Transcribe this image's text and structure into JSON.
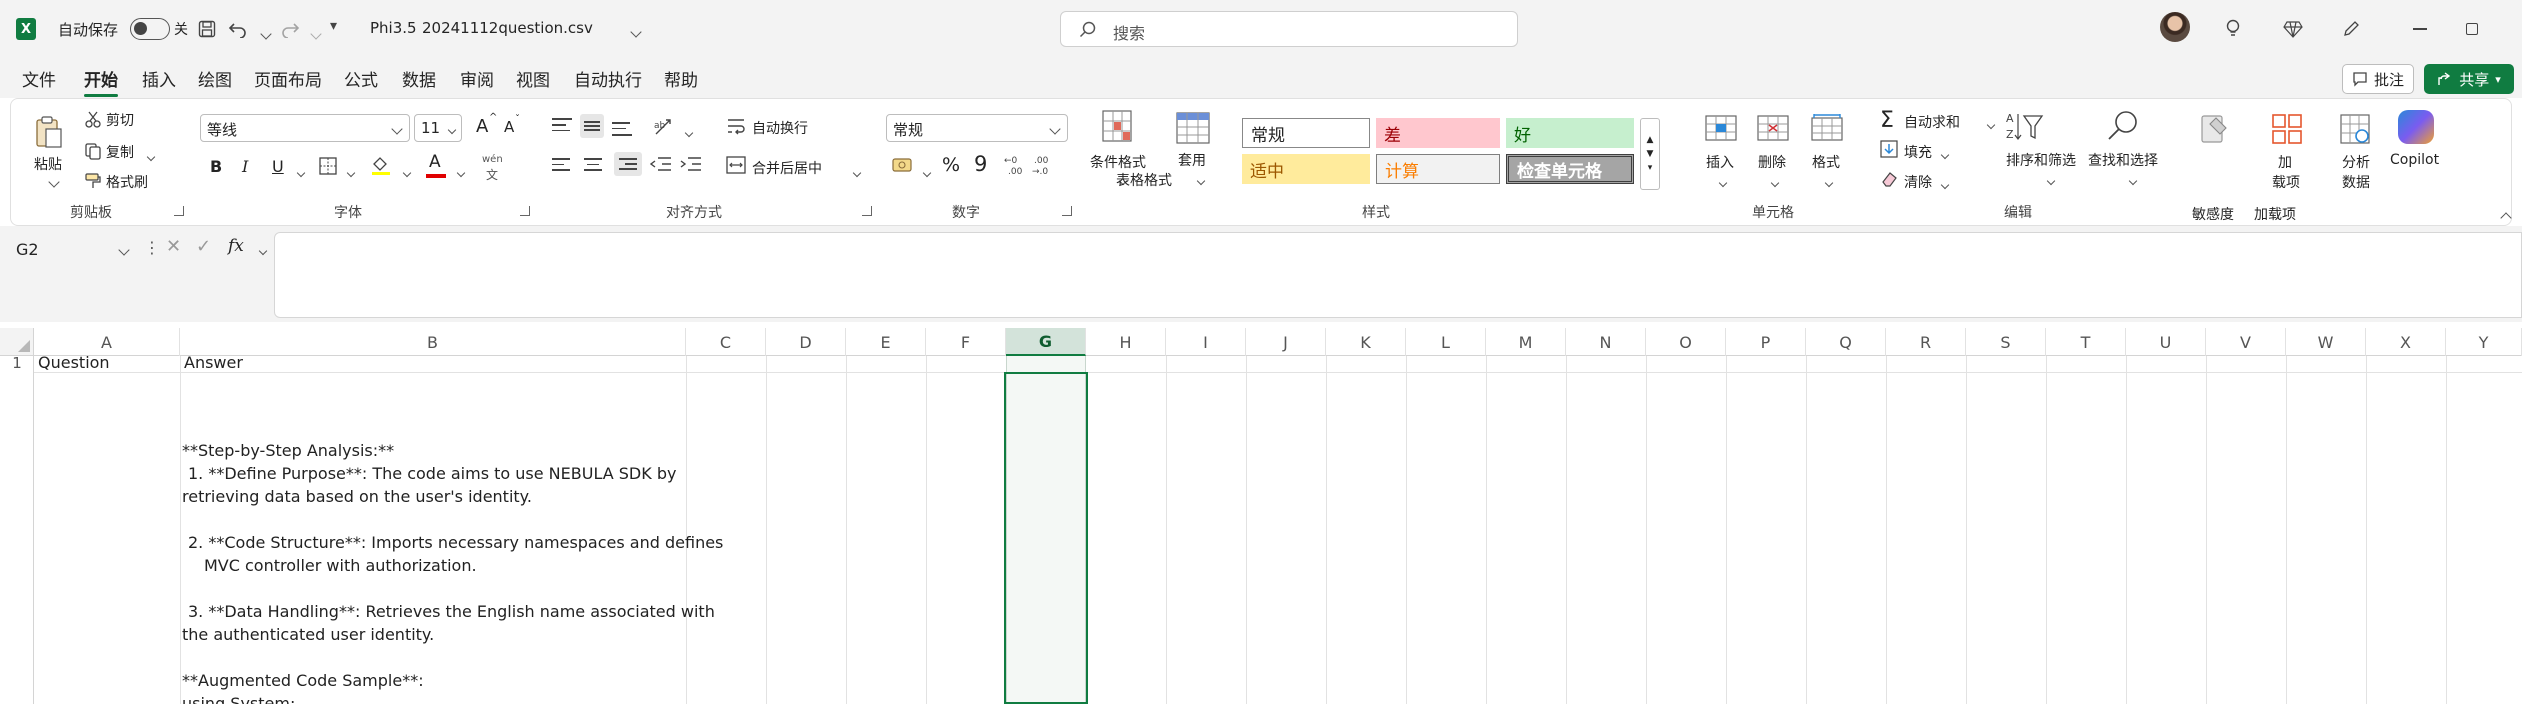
{
  "titlebar": {
    "autosave_label": "自动保存",
    "autosave_state": "关",
    "file_prefix": "Phi3.5",
    "file_name": "20241112question.csv",
    "search_placeholder": "搜索"
  },
  "menu": {
    "tabs": [
      "文件",
      "开始",
      "插入",
      "绘图",
      "页面布局",
      "公式",
      "数据",
      "审阅",
      "视图",
      "自动执行",
      "帮助"
    ],
    "active_tab": "开始",
    "comment_label": "批注",
    "share_label": "共享"
  },
  "ribbon": {
    "clipboard": {
      "paste": "粘贴",
      "cut": "剪切",
      "copy": "复制",
      "format_painter": "格式刷",
      "group": "剪贴板"
    },
    "font": {
      "name": "等线",
      "size": "11",
      "group": "字体",
      "bold": "B",
      "italic": "I",
      "underline": "U",
      "grow": "A",
      "shrink": "A",
      "phonetic": "wén"
    },
    "alignment": {
      "wrap": "自动换行",
      "merge": "合并后居中",
      "group": "对齐方式"
    },
    "number": {
      "format": "常规",
      "percent": "%",
      "comma": "9",
      "group": "数字"
    },
    "styles": {
      "conditional": "条件格式",
      "table": "套用",
      "table_format": "表格格式",
      "normal": "常规",
      "bad": "差",
      "good": "好",
      "neutral": "适中",
      "calculation": "计算",
      "check_cell": "检查单元格",
      "group": "样式"
    },
    "cells": {
      "insert": "插入",
      "delete": "删除",
      "format": "格式",
      "group": "单元格"
    },
    "editing": {
      "autosum": "自动求和",
      "fill": "填充",
      "clear": "清除",
      "sort": "排序和筛选",
      "find": "查找和选择",
      "group": "编辑"
    },
    "sensitivity": "敏感度",
    "addins": {
      "label_a": "加",
      "label_b": "载项",
      "group": "加载项"
    },
    "analyze": {
      "label_a": "分析",
      "label_b": "数据"
    },
    "copilot": "Copilot"
  },
  "formula_bar": {
    "name_box": "G2",
    "fx": "fx",
    "formula": ""
  },
  "grid": {
    "columns": [
      "A",
      "B",
      "C",
      "D",
      "E",
      "F",
      "G",
      "H",
      "I",
      "J",
      "K",
      "L",
      "M",
      "N",
      "O",
      "P",
      "Q",
      "R",
      "S",
      "T",
      "U",
      "V",
      "W",
      "X",
      "Y"
    ],
    "row1": {
      "a": "Question",
      "b": "Answer",
      "num": "1"
    },
    "answer_lines": [
      "**Step-by-Step Analysis:**",
      "1. **Define Purpose**: The code aims to use NEBULA SDK by",
      "retrieving data based on the user's identity.",
      "2. **Code Structure**: Imports necessary namespaces and defines",
      "MVC controller with authorization.",
      "3. **Data Handling**: Retrieves the English name associated with",
      "the authenticated user identity.",
      "**Augmented Code Sample**:",
      "using System;"
    ]
  },
  "colors": {
    "accent": "#107c41",
    "selected_col": "#e1e8e3",
    "bad_bg": "#ffc7ce",
    "bad_fg": "#9c0006",
    "good_bg": "#c6efce",
    "neutral_bg": "#ffeb9c",
    "neutral_fg": "#9c5700",
    "calc_fg": "#fa7d00",
    "check_bg": "#a5a5a5",
    "share_bg": "#107c41"
  }
}
